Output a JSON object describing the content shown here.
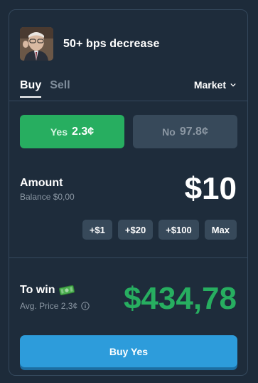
{
  "market": {
    "title": "50+ bps decrease"
  },
  "tabs": [
    {
      "label": "Buy"
    },
    {
      "label": "Sell"
    }
  ],
  "order_type": {
    "label": "Market"
  },
  "outcomes": {
    "yes": {
      "label": "Yes",
      "price": "2.3¢"
    },
    "no": {
      "label": "No",
      "price": "97.8¢"
    }
  },
  "amount": {
    "label": "Amount",
    "balance": "Balance $0,00",
    "value": "$10"
  },
  "quick_add": [
    "+$1",
    "+$20",
    "+$100",
    "Max"
  ],
  "to_win": {
    "label": "To win",
    "avg_price": "Avg. Price 2,3¢",
    "value": "$434,78",
    "icon": "money-icon"
  },
  "buy_button": {
    "label": "Buy Yes"
  },
  "colors": {
    "yes": "#27ae60",
    "no": "#37495a",
    "buy": "#2d9cdb",
    "background": "#1e2c3b"
  }
}
